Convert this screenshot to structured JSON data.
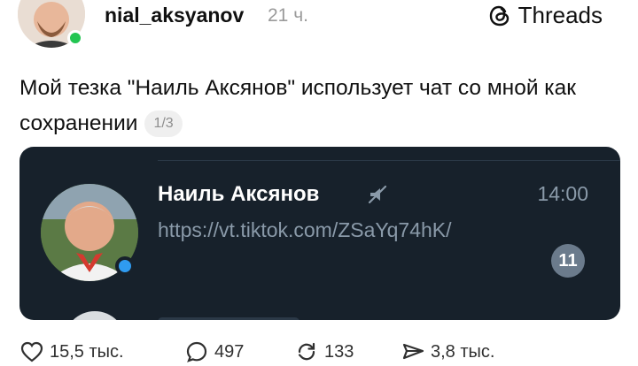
{
  "post": {
    "username": "nial_aksyanov",
    "time": "21 ч.",
    "brand": "Threads",
    "text": "Мой тезка \"Наиль Аксянов\" использует чат со мной как сохранении",
    "page_indicator": "1/3"
  },
  "chat_preview": {
    "name": "Наиль Аксянов",
    "time": "14:00",
    "message": "https://vt.tiktok.com/ZSaYq74hK/",
    "unread_count": "11"
  },
  "actions": {
    "likes": "15,5 тыс.",
    "comments": "497",
    "reposts": "133",
    "shares": "3,8 тыс."
  },
  "colors": {
    "online": "#23c552",
    "card_bg": "#17212b",
    "chat_online": "#2f9bf0"
  }
}
